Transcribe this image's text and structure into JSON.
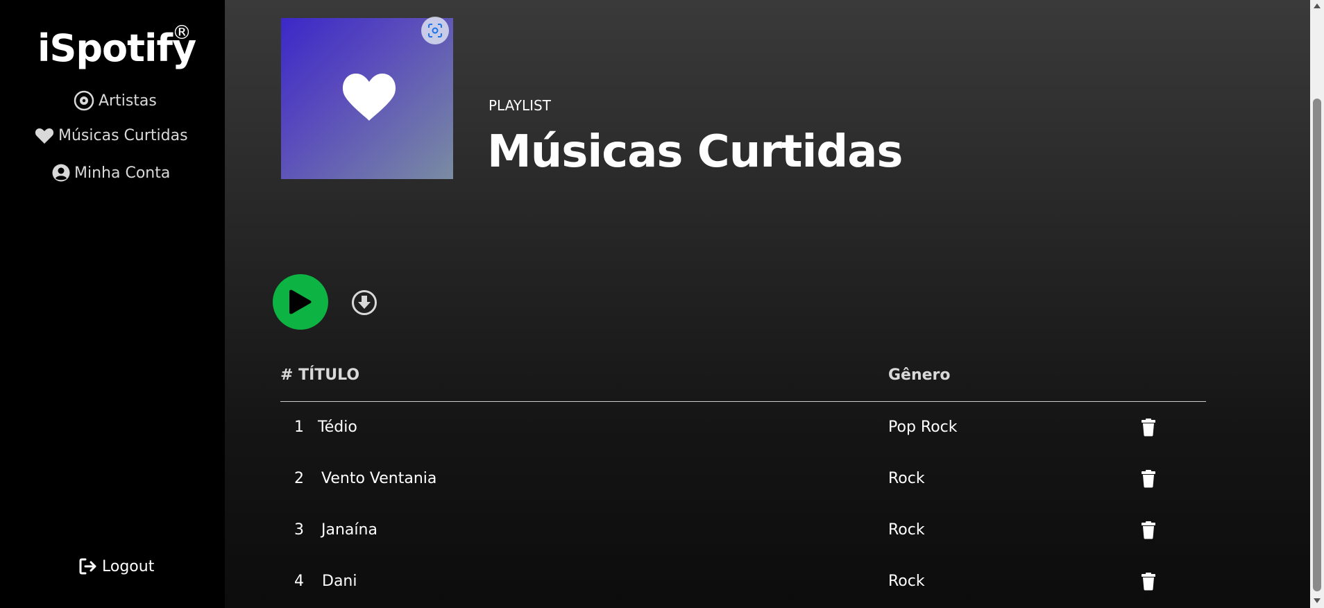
{
  "sidebar": {
    "logo": "iSpotify",
    "logo_mark": "®",
    "items": [
      {
        "label": "Artistas",
        "icon": "vinyl-icon"
      },
      {
        "label": "Músicas Curtidas",
        "icon": "heart-icon"
      },
      {
        "label": "Minha Conta",
        "icon": "user-circle-icon"
      }
    ],
    "logout": {
      "label": "Logout",
      "icon": "logout-icon"
    }
  },
  "playlist": {
    "label": "PLAYLIST",
    "title": "Músicas Curtidas"
  },
  "controls": {
    "play_icon": "play-icon",
    "download_icon": "download-icon"
  },
  "table": {
    "col_title": "# TÍTULO",
    "col_genre": "Gênero",
    "rows": [
      {
        "num": "1",
        "title": "Tédio",
        "genre": "Pop Rock"
      },
      {
        "num": "2",
        "title": "Vento Ventania",
        "genre": "Rock"
      },
      {
        "num": "3",
        "title": "Janaína",
        "genre": "Rock"
      },
      {
        "num": "4",
        "title": "Dani",
        "genre": "Rock"
      }
    ]
  },
  "colors": {
    "accent": "#0db343",
    "sidebar_bg": "#000000",
    "cover_start": "#3b28c8",
    "cover_end": "#7a8ca2"
  }
}
